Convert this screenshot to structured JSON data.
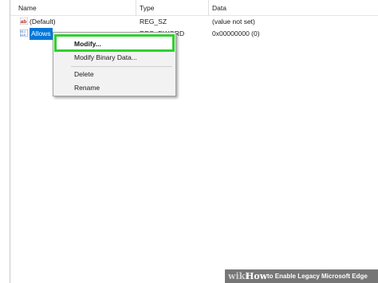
{
  "columns": {
    "name": "Name",
    "type": "Type",
    "data": "Data"
  },
  "rows": [
    {
      "icon": "string-value-icon",
      "name": "(Default)",
      "type": "REG_SZ",
      "data": "(value not set)",
      "selected": false
    },
    {
      "icon": "binary-value-icon",
      "name": "Allows",
      "type": "REG_DWORD",
      "data": "0x00000000 (0)",
      "selected": true
    }
  ],
  "context_menu": {
    "items": [
      {
        "label": "Modify...",
        "highlighted": true
      },
      {
        "label": "Modify Binary Data...",
        "highlighted": false
      },
      {
        "label": "Delete",
        "highlighted": false
      },
      {
        "label": "Rename",
        "highlighted": false
      }
    ]
  },
  "banner": {
    "wiki": "wiki",
    "how": "How",
    "title": "to Enable Legacy Microsoft Edge"
  },
  "colors": {
    "selection": "#0078d7",
    "highlight_border": "#2ed12e",
    "menu_bg": "#f2f2f2"
  }
}
